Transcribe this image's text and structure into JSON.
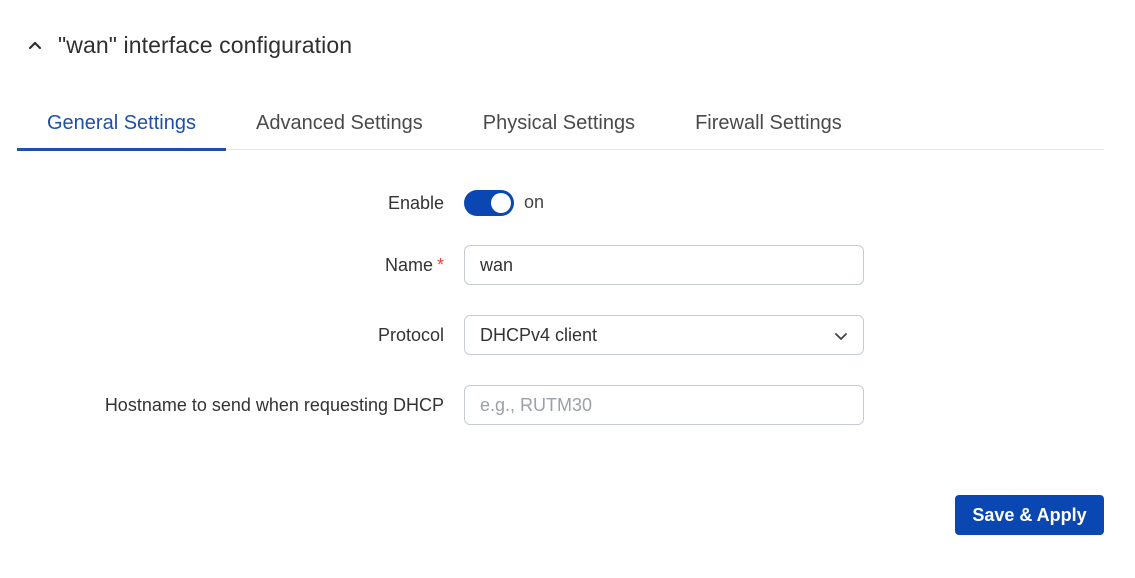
{
  "section": {
    "title": "\"wan\" interface configuration",
    "collapse_icon": "chevron-up-icon"
  },
  "tabs": [
    {
      "label": "General Settings",
      "active": true
    },
    {
      "label": "Advanced Settings",
      "active": false
    },
    {
      "label": "Physical Settings",
      "active": false
    },
    {
      "label": "Firewall Settings",
      "active": false
    }
  ],
  "form": {
    "enable": {
      "label": "Enable",
      "state_text": "on",
      "checked": true
    },
    "name": {
      "label": "Name",
      "required_mark": "*",
      "value": "wan"
    },
    "protocol": {
      "label": "Protocol",
      "value": "DHCPv4 client",
      "icon": "chevron-down-icon"
    },
    "hostname": {
      "label": "Hostname to send when requesting DHCP",
      "value": "",
      "placeholder": "e.g., RUTM30"
    }
  },
  "actions": {
    "save_apply_label": "Save & Apply"
  },
  "colors": {
    "accent": "#0a47b2",
    "active_tab": "#1f4fa8",
    "required": "#e0463c"
  }
}
